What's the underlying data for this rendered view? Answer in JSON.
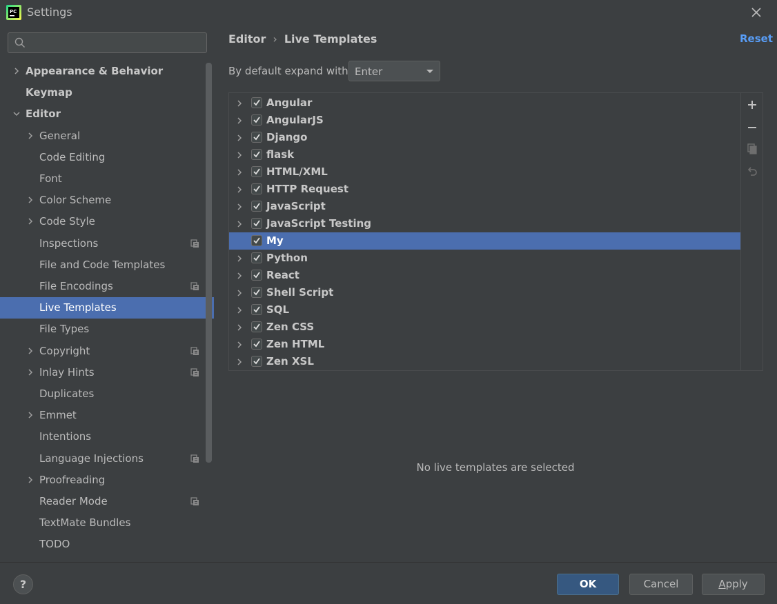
{
  "window": {
    "title": "Settings",
    "logo_text": "PC"
  },
  "search": {
    "value": "",
    "placeholder": ""
  },
  "sidebar": {
    "items": [
      {
        "label": "Appearance & Behavior",
        "level": 0,
        "chevron": "right",
        "bold": true
      },
      {
        "label": "Keymap",
        "level": 0,
        "chevron": "none",
        "bold": true
      },
      {
        "label": "Editor",
        "level": 0,
        "chevron": "down",
        "bold": true
      },
      {
        "label": "General",
        "level": 1,
        "chevron": "right"
      },
      {
        "label": "Code Editing",
        "level": 1,
        "chevron": "none"
      },
      {
        "label": "Font",
        "level": 1,
        "chevron": "none"
      },
      {
        "label": "Color Scheme",
        "level": 1,
        "chevron": "right"
      },
      {
        "label": "Code Style",
        "level": 1,
        "chevron": "right"
      },
      {
        "label": "Inspections",
        "level": 1,
        "chevron": "none",
        "project_icon": true
      },
      {
        "label": "File and Code Templates",
        "level": 1,
        "chevron": "none"
      },
      {
        "label": "File Encodings",
        "level": 1,
        "chevron": "none",
        "project_icon": true
      },
      {
        "label": "Live Templates",
        "level": 1,
        "chevron": "none",
        "selected": true
      },
      {
        "label": "File Types",
        "level": 1,
        "chevron": "none"
      },
      {
        "label": "Copyright",
        "level": 1,
        "chevron": "right",
        "project_icon": true
      },
      {
        "label": "Inlay Hints",
        "level": 1,
        "chevron": "right",
        "project_icon": true
      },
      {
        "label": "Duplicates",
        "level": 1,
        "chevron": "none"
      },
      {
        "label": "Emmet",
        "level": 1,
        "chevron": "right"
      },
      {
        "label": "Intentions",
        "level": 1,
        "chevron": "none"
      },
      {
        "label": "Language Injections",
        "level": 1,
        "chevron": "none",
        "project_icon": true
      },
      {
        "label": "Proofreading",
        "level": 1,
        "chevron": "right"
      },
      {
        "label": "Reader Mode",
        "level": 1,
        "chevron": "none",
        "project_icon": true
      },
      {
        "label": "TextMate Bundles",
        "level": 1,
        "chevron": "none"
      },
      {
        "label": "TODO",
        "level": 1,
        "chevron": "none"
      }
    ]
  },
  "header": {
    "breadcrumb": [
      "Editor",
      "Live Templates"
    ],
    "breadcrumb_sep": "›",
    "reset_label": "Reset"
  },
  "expand": {
    "label": "By default expand with",
    "value": "Enter"
  },
  "templates": [
    {
      "label": "Angular",
      "checked": true,
      "expandable": true
    },
    {
      "label": "AngularJS",
      "checked": true,
      "expandable": true
    },
    {
      "label": "Django",
      "checked": true,
      "expandable": true
    },
    {
      "label": "flask",
      "checked": true,
      "expandable": true
    },
    {
      "label": "HTML/XML",
      "checked": true,
      "expandable": true
    },
    {
      "label": "HTTP Request",
      "checked": true,
      "expandable": true
    },
    {
      "label": "JavaScript",
      "checked": true,
      "expandable": true
    },
    {
      "label": "JavaScript Testing",
      "checked": true,
      "expandable": true
    },
    {
      "label": "My",
      "checked": true,
      "expandable": false,
      "selected": true
    },
    {
      "label": "Python",
      "checked": true,
      "expandable": true
    },
    {
      "label": "React",
      "checked": true,
      "expandable": true
    },
    {
      "label": "Shell Script",
      "checked": true,
      "expandable": true
    },
    {
      "label": "SQL",
      "checked": true,
      "expandable": true
    },
    {
      "label": "Zen CSS",
      "checked": true,
      "expandable": true
    },
    {
      "label": "Zen HTML",
      "checked": true,
      "expandable": true
    },
    {
      "label": "Zen XSL",
      "checked": true,
      "expandable": true
    }
  ],
  "toolbar": {
    "icons": [
      "plus-icon",
      "minus-icon",
      "copy-icon",
      "undo-icon"
    ]
  },
  "empty_message": "No live templates are selected",
  "footer": {
    "help_label": "?",
    "ok_label": "OK",
    "cancel_label": "Cancel",
    "apply_label_mnemonic": "A",
    "apply_label_rest": "pply"
  },
  "colors": {
    "background": "#3c3f41",
    "selection": "#4b6eaf",
    "link": "#589df6",
    "primary_button": "#365880"
  }
}
